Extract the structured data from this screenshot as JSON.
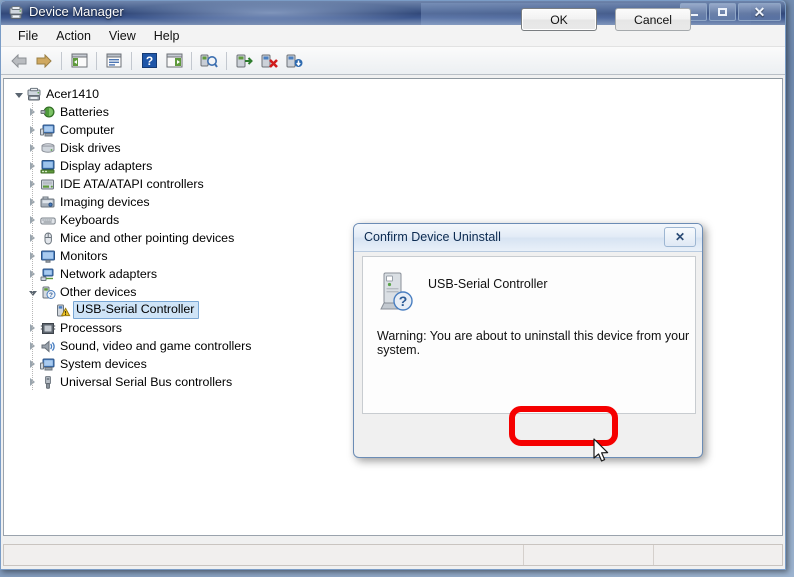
{
  "window": {
    "title": "Device Manager",
    "icon": "device-manager-icon",
    "buttons": {
      "minimize": "–",
      "maximize": "□",
      "close": "✕"
    }
  },
  "menubar": {
    "items": [
      {
        "label": "File"
      },
      {
        "label": "Action"
      },
      {
        "label": "View"
      },
      {
        "label": "Help"
      }
    ]
  },
  "toolbar": {
    "buttons": [
      {
        "name": "back-icon"
      },
      {
        "name": "forward-icon"
      },
      {
        "name": "show-hide-console-tree-icon"
      },
      {
        "name": "properties-icon"
      },
      {
        "name": "help-icon"
      },
      {
        "name": "show-hide-action-pane-icon"
      },
      {
        "name": "scan-for-hardware-changes-icon"
      },
      {
        "name": "update-driver-software-icon"
      },
      {
        "name": "uninstall-device-icon"
      },
      {
        "name": "disable-device-icon"
      }
    ]
  },
  "tree": {
    "root": {
      "label": "Acer1410",
      "icon": "computer-icon",
      "expanded": true
    },
    "items": [
      {
        "label": "Batteries",
        "icon": "battery-icon",
        "level": 1,
        "expanded": false
      },
      {
        "label": "Computer",
        "icon": "computer-icon",
        "level": 1,
        "expanded": false
      },
      {
        "label": "Disk drives",
        "icon": "disk-drive-icon",
        "level": 1,
        "expanded": false
      },
      {
        "label": "Display adapters",
        "icon": "display-adapter-icon",
        "level": 1,
        "expanded": false
      },
      {
        "label": "IDE ATA/ATAPI controllers",
        "icon": "ide-controller-icon",
        "level": 1,
        "expanded": false
      },
      {
        "label": "Imaging devices",
        "icon": "imaging-device-icon",
        "level": 1,
        "expanded": false
      },
      {
        "label": "Keyboards",
        "icon": "keyboard-icon",
        "level": 1,
        "expanded": false
      },
      {
        "label": "Mice and other pointing devices",
        "icon": "mouse-icon",
        "level": 1,
        "expanded": false
      },
      {
        "label": "Monitors",
        "icon": "monitor-icon",
        "level": 1,
        "expanded": false
      },
      {
        "label": "Network adapters",
        "icon": "network-adapter-icon",
        "level": 1,
        "expanded": false
      },
      {
        "label": "Other devices",
        "icon": "unknown-device-icon",
        "level": 1,
        "expanded": true
      },
      {
        "label": "USB-Serial Controller",
        "icon": "warning-device-icon",
        "level": 2,
        "selected": true
      },
      {
        "label": "Processors",
        "icon": "processor-icon",
        "level": 1,
        "expanded": false
      },
      {
        "label": "Sound, video and game controllers",
        "icon": "sound-controller-icon",
        "level": 1,
        "expanded": false
      },
      {
        "label": "System devices",
        "icon": "system-device-icon",
        "level": 1,
        "expanded": false
      },
      {
        "label": "Universal Serial Bus controllers",
        "icon": "usb-controller-icon",
        "level": 1,
        "expanded": false
      }
    ]
  },
  "statusbar": {
    "pane1": "",
    "pane2": "",
    "pane3": ""
  },
  "dialog": {
    "title": "Confirm Device Uninstall",
    "close_label": "✕",
    "device_icon": "unknown-device-question-icon",
    "device_name": "USB-Serial Controller",
    "warning": "Warning: You are about to uninstall this device from your system.",
    "ok_label": "OK",
    "cancel_label": "Cancel"
  },
  "annotation": {
    "highlight_color": "#f50000",
    "target": "OK"
  },
  "colors": {
    "titlebar": "#32497a",
    "selection": "#cfe4f7",
    "selection_border": "#7aa7d4",
    "highlight": "#f50000"
  }
}
